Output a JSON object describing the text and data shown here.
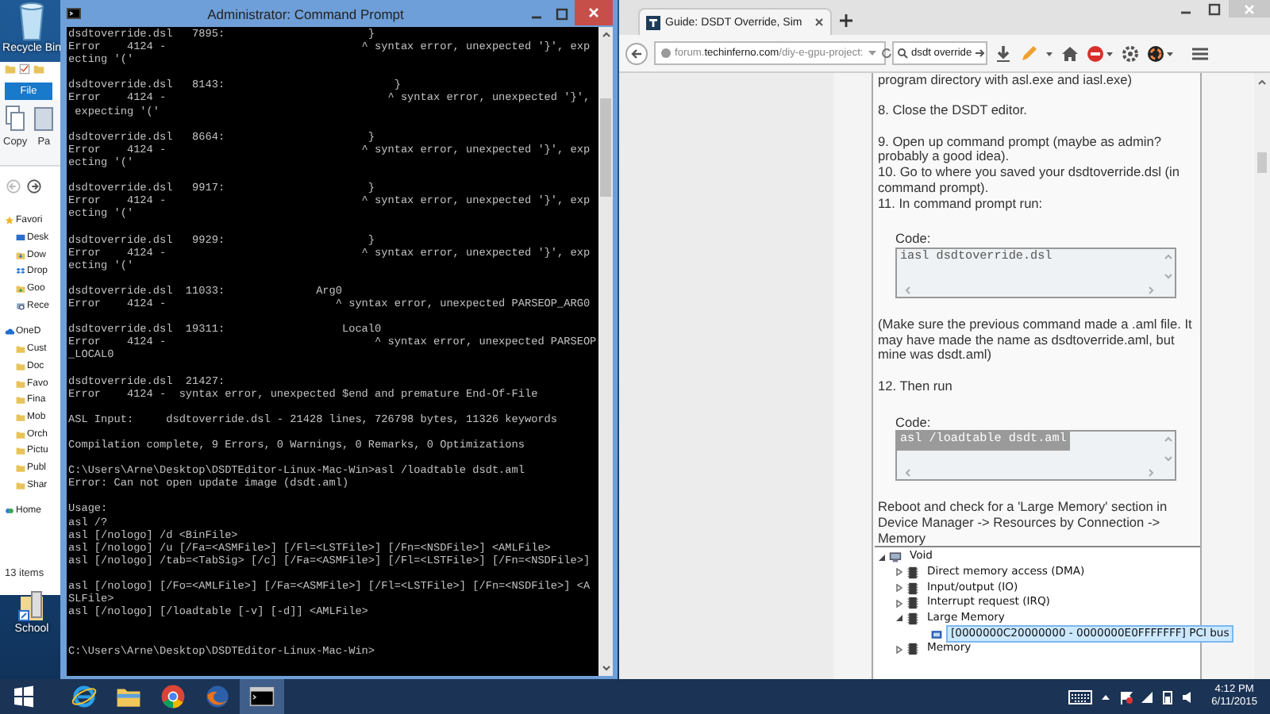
{
  "desktop": {
    "icons": [
      {
        "label": "Recycle Bin",
        "kind": "recycle"
      },
      {
        "label": "School",
        "kind": "shortcut"
      }
    ]
  },
  "explorer": {
    "ribbon_tab": "File",
    "ribbon_buttons": [
      {
        "label": "Copy",
        "kind": "copy"
      },
      {
        "label": "Pa",
        "kind": "paste"
      }
    ],
    "nav_tree": [
      {
        "label": "Favori",
        "kind": "star",
        "children": [
          {
            "label": "Desk",
            "kind": "desktop"
          },
          {
            "label": "Dow",
            "kind": "download"
          },
          {
            "label": "Drop",
            "kind": "dropbox"
          },
          {
            "label": "Goo",
            "kind": "drive"
          },
          {
            "label": "Rece",
            "kind": "recent"
          }
        ]
      },
      {
        "label": "OneD",
        "kind": "cloud",
        "children": [
          {
            "label": "Cust",
            "kind": "folder"
          },
          {
            "label": "Doc",
            "kind": "folder"
          },
          {
            "label": "Favo",
            "kind": "folder"
          },
          {
            "label": "Fina",
            "kind": "folder"
          },
          {
            "label": "Mob",
            "kind": "folder"
          },
          {
            "label": "Orch",
            "kind": "folder"
          },
          {
            "label": "Pictu",
            "kind": "folder"
          },
          {
            "label": "Publ",
            "kind": "folder"
          },
          {
            "label": "Shar",
            "kind": "folder"
          }
        ]
      },
      {
        "label": "Home",
        "kind": "homegroup"
      }
    ],
    "status": "13 items"
  },
  "cmd": {
    "title": "Administrator: Command Prompt",
    "output_blocks": [
      [
        "dsdtoverride.dsl   7895:                      }",
        "Error    4124 -                              ^ syntax error, unexpected '}', exp",
        "ecting '('"
      ],
      [
        "dsdtoverride.dsl   8143:                          }",
        "Error    4124 -                                  ^ syntax error, unexpected '}',",
        " expecting '('"
      ],
      [
        "dsdtoverride.dsl   8664:                      }",
        "Error    4124 -                              ^ syntax error, unexpected '}', exp",
        "ecting '('"
      ],
      [
        "dsdtoverride.dsl   9917:                      }",
        "Error    4124 -                              ^ syntax error, unexpected '}', exp",
        "ecting '('"
      ],
      [
        "dsdtoverride.dsl   9929:                      }",
        "Error    4124 -                              ^ syntax error, unexpected '}', exp",
        "ecting '('"
      ],
      [
        "dsdtoverride.dsl  11033:              Arg0",
        "Error    4124 -                          ^ syntax error, unexpected PARSEOP_ARG0"
      ],
      [
        "dsdtoverride.dsl  19311:                  Local0",
        "Error    4124 -                                ^ syntax error, unexpected PARSEOP",
        "_LOCAL0"
      ],
      [
        "dsdtoverride.dsl  21427:",
        "Error    4124 -  syntax error, unexpected $end and premature End-Of-File"
      ],
      [
        "ASL Input:     dsdtoverride.dsl - 21428 lines, 726798 bytes, 11326 keywords"
      ],
      [
        "Compilation complete, 9 Errors, 0 Warnings, 0 Remarks, 0 Optimizations"
      ],
      [
        "C:\\Users\\Arne\\Desktop\\DSDTEditor-Linux-Mac-Win>asl /loadtable dsdt.aml",
        "Error: Can not open update image (dsdt.aml)"
      ],
      [
        "Usage:",
        "asl /?",
        "asl [/nologo] /d <BinFile>",
        "asl [/nologo] /u [/Fa=<ASMFile>] [/Fl=<LSTFile>] [/Fn=<NSDFile>] <AMLFile>",
        "asl [/nologo] /tab=<TabSig> [/c] [/Fa=<ASMFile>] [/Fl=<LSTFile>] [/Fn=<NSDFile>]"
      ],
      [
        "asl [/nologo] [/Fo=<AMLFile>] [/Fa=<ASMFile>] [/Fl=<LSTFile>] [/Fn=<NSDFile>] <A",
        "SLFile>",
        "asl [/nologo] [/loadtable [-v] [-d]] <AMLFile>"
      ]
    ],
    "prompt": "C:\\Users\\Arne\\Desktop\\DSDTEditor-Linux-Mac-Win>"
  },
  "browser": {
    "tabs": [
      {
        "title": "Guide: DSDT Override, Sim",
        "selected": true
      }
    ],
    "url": {
      "subdomain": "forum.",
      "domain": "techinferno.com",
      "path": "/diy-e-gpu-project:"
    },
    "search": {
      "value": "dsdt override"
    },
    "post": [
      {
        "kind": "text",
        "lines": [
          "program directory with asl.exe and iasl.exe)"
        ]
      },
      {
        "kind": "text",
        "lines": [
          "8. Close the DSDT editor."
        ]
      },
      {
        "kind": "text",
        "lines": [
          "9. Open up command prompt (maybe as admin?",
          "probably a good idea).",
          "10. Go to where you saved your dsdtoverride.dsl (in",
          "command prompt).",
          "11. In command prompt run:"
        ]
      },
      {
        "kind": "code",
        "label": "Code:",
        "code": "iasl dsdtoverride.dsl",
        "selected": false
      },
      {
        "kind": "text",
        "lines": [
          "(Make sure the previous command made a .aml file. It",
          "may have made the name as dsdtoverride.aml, but",
          "mine was dsdt.aml)"
        ]
      },
      {
        "kind": "text",
        "lines": [
          "12. Then run"
        ]
      },
      {
        "kind": "code",
        "label": "Code:",
        "code": "asl /loadtable dsdt.aml",
        "selected": true
      },
      {
        "kind": "text",
        "lines": [
          "Reboot and check for a 'Large Memory' section in",
          "Device Manager -> Resources by Connection ->",
          "Memory"
        ]
      },
      {
        "kind": "tree",
        "nodes": [
          {
            "label": "Void",
            "kind": "computer",
            "expanded": true,
            "selected": false,
            "children": [
              {
                "label": "Direct memory access (DMA)",
                "kind": "chip",
                "expanded": false,
                "selected": false
              },
              {
                "label": "Input/output (IO)",
                "kind": "chip",
                "expanded": false,
                "selected": false
              },
              {
                "label": "Interrupt request (IRQ)",
                "kind": "chip",
                "expanded": false,
                "selected": false
              },
              {
                "label": "Large Memory",
                "kind": "chip",
                "expanded": true,
                "selected": false,
                "children": [
                  {
                    "label": "[0000000C20000000 - 0000000E0FFFFFFF]  PCI bus",
                    "kind": "device",
                    "selected": true
                  }
                ]
              },
              {
                "label": "Memory",
                "kind": "chip",
                "expanded": false,
                "selected": false
              }
            ]
          }
        ]
      }
    ]
  },
  "taskbar": {
    "apps": [
      {
        "kind": "ie",
        "selected": false
      },
      {
        "kind": "explorer",
        "selected": false
      },
      {
        "kind": "chrome",
        "selected": false
      },
      {
        "kind": "firefox",
        "selected": false
      },
      {
        "kind": "cmd",
        "selected": true
      }
    ],
    "clock": {
      "time": "4:12 PM",
      "date": "6/11/2015"
    }
  }
}
